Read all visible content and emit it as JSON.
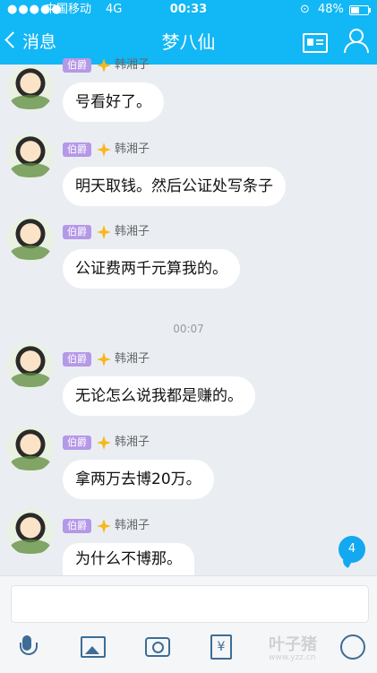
{
  "status_bar": {
    "signal": "●●●●●",
    "carrier": "中国移动",
    "network": "4G",
    "time": "00:33",
    "lock_icon": "lock-rotation-icon",
    "battery_percent": "48%",
    "battery_level": 0.48
  },
  "nav": {
    "back_label": "消息",
    "title": "梦八仙",
    "right_icons": [
      "profile-card-icon",
      "group-icon"
    ]
  },
  "messages": [
    {
      "badge": "伯爵",
      "sender": "韩湘子",
      "text": "号看好了。"
    },
    {
      "badge": "伯爵",
      "sender": "韩湘子",
      "text": "明天取钱。然后公证处写条子"
    },
    {
      "badge": "伯爵",
      "sender": "韩湘子",
      "text": "公证费两千元算我的。"
    },
    {
      "badge": "伯爵",
      "sender": "韩湘子",
      "text": "无论怎么说我都是赚的。"
    },
    {
      "badge": "伯爵",
      "sender": "韩湘子",
      "text": "拿两万去博20万。"
    },
    {
      "badge": "伯爵",
      "sender": "韩湘子",
      "text": "为什么不博那。"
    }
  ],
  "timestamp": "00:07",
  "unread_count": "4",
  "input": {
    "placeholder": ""
  },
  "toolbar": {
    "icons": [
      "mic-icon",
      "image-icon",
      "camera-icon",
      "red-packet-icon",
      "emoji-icon"
    ],
    "wallet_symbol": "¥"
  },
  "watermark": {
    "text": "叶子猪",
    "url": "www.yzz.cn"
  },
  "colors": {
    "header": "#12b7f5",
    "background": "#eaeef3",
    "badge": "#b598e8",
    "unread": "#12a9f0"
  }
}
